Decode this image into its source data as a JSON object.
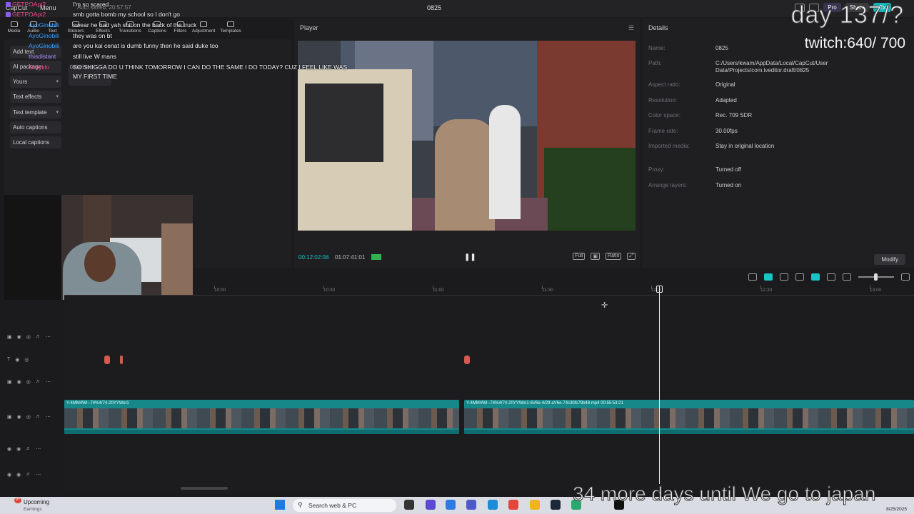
{
  "titlebar": {
    "app_name": "CapCut",
    "menu_label": "Menu",
    "autosave": "Auto saved: 20:57:57",
    "project_title": "0825",
    "pro_label": "Pro",
    "share_label": "Share",
    "export_label": "Ex"
  },
  "toolbar": {
    "items": [
      "Media",
      "Audio",
      "Text",
      "Stickers",
      "Effects",
      "Transitions",
      "Captions",
      "Filters",
      "Adjustment",
      "Templates"
    ]
  },
  "left_panel": {
    "items": [
      "Add text",
      "AI package",
      "Yours",
      "Text effects",
      "Text template",
      "Auto captions",
      "Local captions"
    ],
    "preview_label": "Default text"
  },
  "chat": [
    {
      "user": "GETPOApt2",
      "color": "pink",
      "message": "I'm so scared"
    },
    {
      "user": "GETPOApt2",
      "color": "pink",
      "message": "smb gotta bomb my school so I don't go"
    },
    {
      "user": "AyoGinobili",
      "color": "blue",
      "message": "swear he had yah shit on the back of the truck"
    },
    {
      "user": "AyoGinobili",
      "color": "blue",
      "message": "they was on bt"
    },
    {
      "user": "AyoGinobili",
      "color": "blue",
      "message": "are you kai cenat is dumb funny then he said duke too"
    },
    {
      "user": "thisdistant",
      "color": "purple",
      "message": "still live W mans"
    },
    {
      "user": "Greyklo",
      "color": "pink",
      "message": "SO SHIGGA DO U THINK TOMORROW I CAN DO THE SAME I DO TODAY? CUZ I FEEL LIKE WAS"
    },
    {
      "user": "",
      "color": "pink",
      "message": "MY FIRST TIME"
    }
  ],
  "player": {
    "title": "Player",
    "time_current": "00:12:02:08",
    "time_total": "01:07:41:01",
    "ctrl_full": "Full",
    "ctrl_ratio": "Ratio"
  },
  "details": {
    "title": "Details",
    "rows": [
      {
        "label": "Name:",
        "value": "0825"
      },
      {
        "label": "Path:",
        "value": "C:/Users/kwam/AppData/Local/CapCut/User Data/Projects/com.lveditor.draft/0825"
      },
      {
        "label": "Aspect ratio:",
        "value": "Original"
      },
      {
        "label": "Resolution:",
        "value": "Adapted"
      },
      {
        "label": "Color space:",
        "value": "Rec. 709 SDR"
      },
      {
        "label": "Frame rate:",
        "value": "30.00fps"
      },
      {
        "label": "Imported media:",
        "value": "Stay in original location"
      },
      {
        "label": "Proxy:",
        "value": "Turned off"
      },
      {
        "label": "Arrange layers:",
        "value": "Turned on"
      }
    ],
    "modify_label": "Modify"
  },
  "overlays": {
    "day_counter": "day 137/?",
    "twitch": "twitch:640/ 700",
    "japan": "34 more days until We go to japan"
  },
  "timeline": {
    "ticks": [
      "10:00",
      "10:30",
      "11:00",
      "11:30",
      "12:00",
      "12:30",
      "13:00"
    ],
    "clips": [
      {
        "label": "Y-4MM4WI--74%4/74-20YYWeI1"
      },
      {
        "label": "Y-4MM4WI--74%4/74-20YYWeI1-6V6e-4/29-aV6e-74c30fc79b48.mp4  00:55:53:21"
      }
    ]
  },
  "taskbar": {
    "weather": "Upcoming",
    "weather_sub": "Earnings",
    "weather_badge": "9+",
    "search_placeholder": "Search web & PC",
    "date": "8/25/2025"
  }
}
